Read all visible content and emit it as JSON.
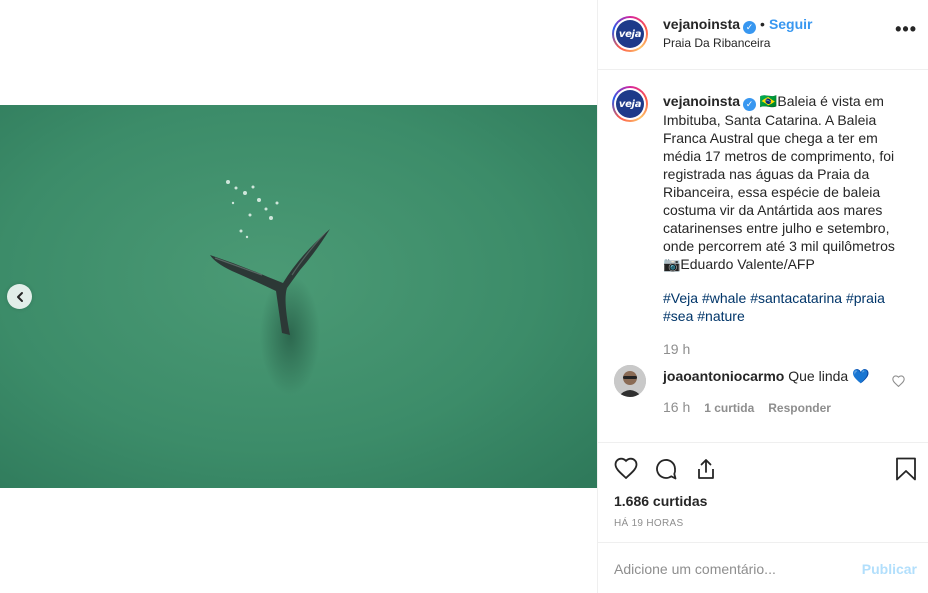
{
  "post": {
    "account": {
      "username": "vejanoinsta",
      "avatar_text": "veja",
      "verified_mark": "✓",
      "follow_separator": "•",
      "follow_label": "Seguir",
      "location": "Praia Da Ribanceira"
    },
    "more_label": "•••",
    "image": {
      "prev_icon": "chevron-left-icon"
    },
    "caption": {
      "username": "vejanoinsta",
      "text_part1": "🇧🇷Baleia é vista em Imbituba, Santa Catarina. A Baleia Franca Austral que chega a ter em média 17 metros de comprimento, foi registrada nas águas da Praia da Ribanceira, essa espécie de baleia costuma vir da Antártida aos mares catarinenses entre julho e setembro, onde percorrem até 3 mil quilômetros",
      "text_part2": "📷Eduardo Valente/AFP",
      "hashtags": [
        "#Veja",
        "#whale",
        "#santacatarina",
        "#praia",
        "#sea",
        "#nature"
      ],
      "time": "19 h"
    },
    "comments": [
      {
        "username": "joaoantoniocarmo",
        "text": "Que linda",
        "emoji": "💙",
        "time": "16 h",
        "likes": "1 curtida",
        "reply_label": "Responder"
      }
    ],
    "actions": {
      "like_icon": "heart-icon",
      "comment_icon": "comment-icon",
      "share_icon": "share-icon",
      "save_icon": "bookmark-icon"
    },
    "likes_count": "1.686 curtidas",
    "timestamp": "HÁ 19 HORAS",
    "add_comment": {
      "placeholder": "Adicione um comentário...",
      "publish_label": "Publicar"
    }
  },
  "colors": {
    "link_blue": "#3897f0",
    "hashtag_blue": "#003569",
    "muted_gray": "#8e8e8e",
    "sea_green": "#3f8f6a",
    "publish_disabled": "#b2dffc",
    "brand_veja": "#1e3a8a"
  }
}
